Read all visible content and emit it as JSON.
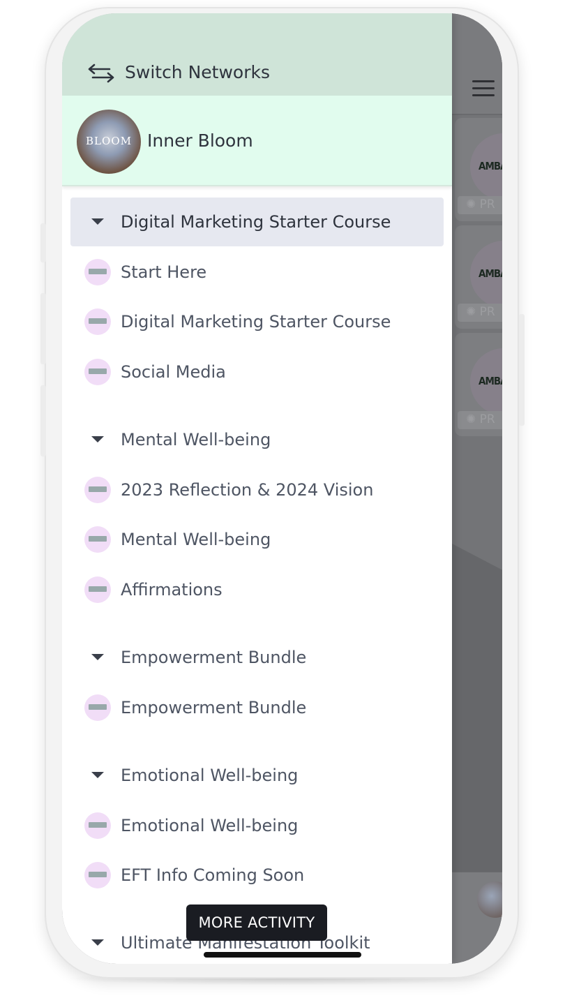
{
  "header": {
    "switch_label": "Switch Networks",
    "network_name": "Inner Bloom",
    "network_logo_text": "BLOOM"
  },
  "menu": {
    "groups": [
      {
        "title": "Digital Marketing Starter Course",
        "items": [
          "Start Here",
          "Digital Marketing Starter Course",
          "Social Media"
        ]
      },
      {
        "title": "Mental Well-being",
        "items": [
          "2023 Reflection & 2024 Vision",
          "Mental Well-being",
          "Affirmations"
        ]
      },
      {
        "title": "Empowerment Bundle",
        "items": [
          "Empowerment Bundle"
        ]
      },
      {
        "title": "Emotional Well-being",
        "items": [
          "Emotional Well-being",
          "EFT Info Coming Soon"
        ]
      },
      {
        "title": "Ultimate Manifestation Toolkit",
        "items": []
      }
    ]
  },
  "background": {
    "card_label": "AMBA",
    "card_pill": "PR"
  },
  "actions": {
    "more_activity": "MORE ACTIVITY"
  },
  "colors": {
    "switch_bar": "#cfe4d8",
    "network_bar": "#e1fcee",
    "active_row": "#e6e8f0",
    "item_icon": "#f1ddf7",
    "text": "#4e5563"
  },
  "icons": {
    "switch": "arrows-swap-icon",
    "group": "caret-down-icon",
    "menu": "hamburger-icon"
  }
}
